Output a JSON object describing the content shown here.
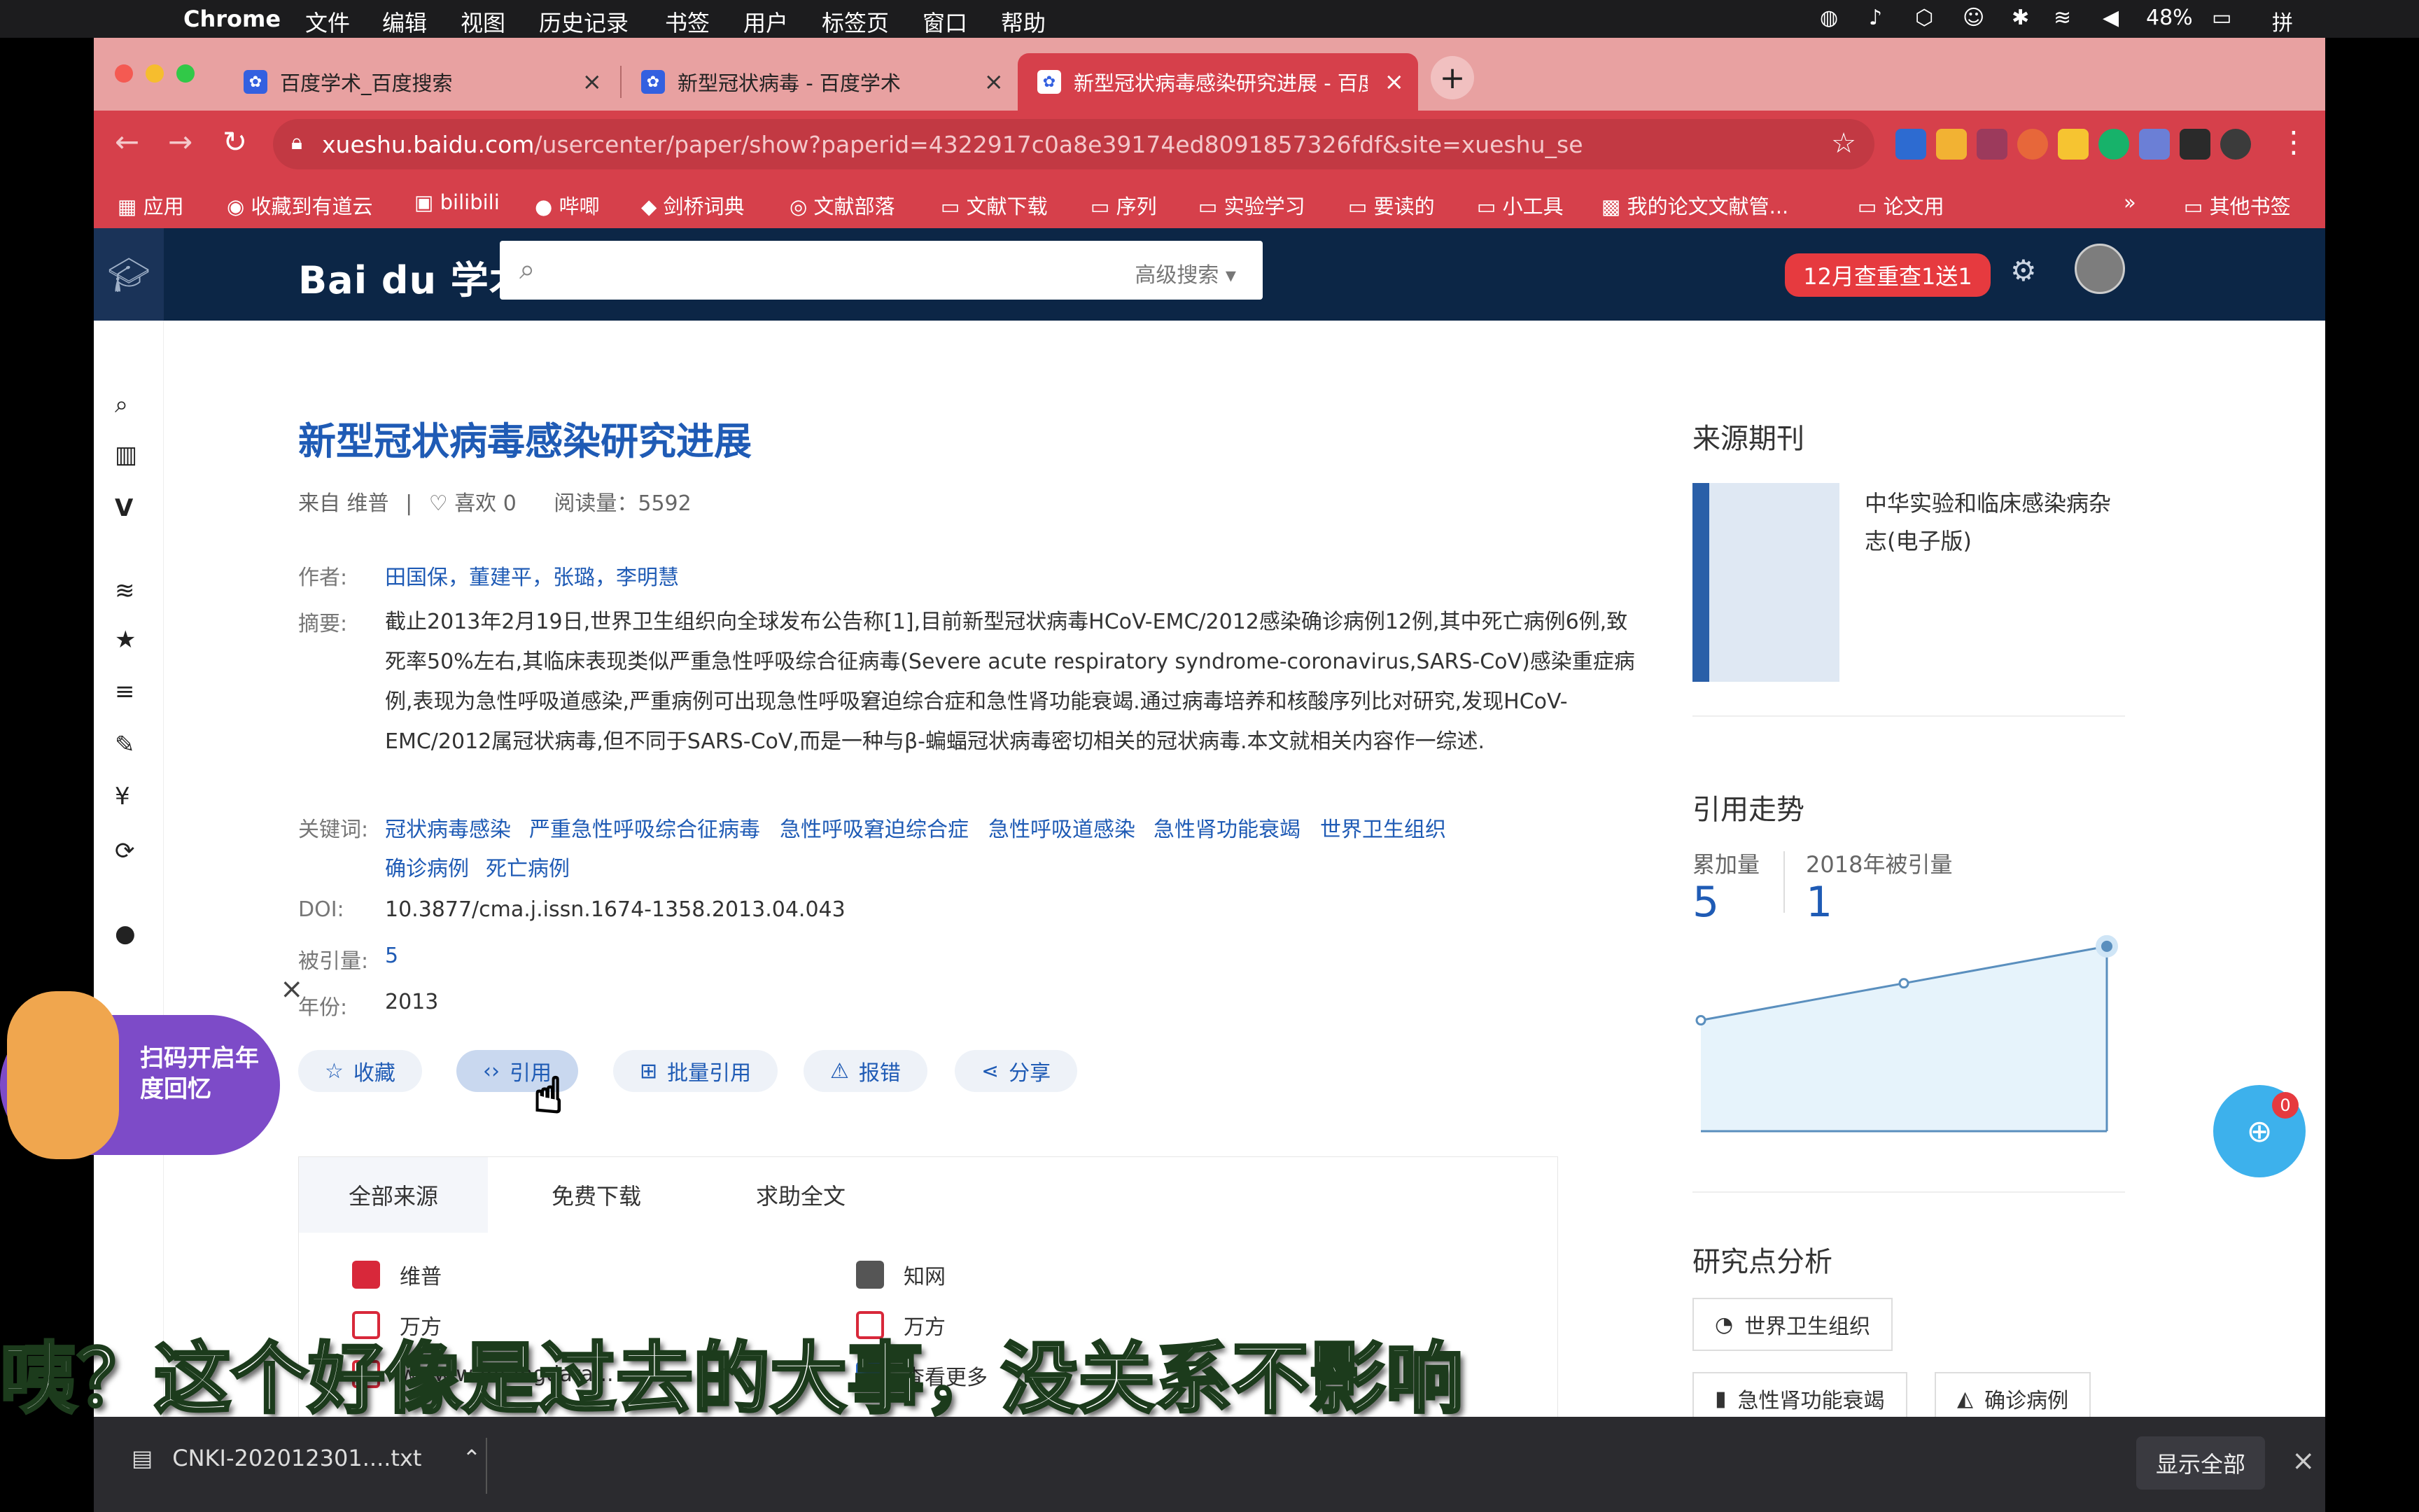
{
  "menubar": {
    "app": "Chrome",
    "items": [
      "文件",
      "编辑",
      "视图",
      "历史记录",
      "书签",
      "用户",
      "标签页",
      "窗口",
      "帮助"
    ],
    "battery": "48%"
  },
  "tabs": [
    {
      "title": "百度学术_百度搜索"
    },
    {
      "title": "新型冠状病毒 - 百度学术"
    },
    {
      "title": "新型冠状病毒感染研究进展 - 百度"
    }
  ],
  "address": {
    "host": "xueshu.baidu.com",
    "path": "/usercenter/paper/show?paperid=4322917c0a8e39174ed8091857326fdf&site=xueshu_se"
  },
  "bookmarks": [
    "应用",
    "收藏到有道云",
    "bilibili",
    "哔唧",
    "剑桥词典",
    "文献部落",
    "文献下载",
    "序列",
    "实验学习",
    "要读的",
    "小工具",
    "我的论文文献管...",
    "论文用",
    "其他书签"
  ],
  "header": {
    "brand": "Bai du 学术",
    "search_placeholder": "",
    "advanced": "高级搜索",
    "promo": "12月查重查1送1"
  },
  "paper": {
    "title": "新型冠状病毒感染研究进展",
    "source": "来自 维普",
    "likes": "喜欢 0",
    "reads": "阅读量：5592",
    "labels": {
      "authors": "作者:",
      "abstract": "摘要:",
      "keywords": "关键词:",
      "doi": "DOI:",
      "cited": "被引量:",
      "year": "年份:"
    },
    "authors": "田国保，董建平，张璐，李明慧",
    "abstract": "截止2013年2月19日,世界卫生组织向全球发布公告称[1],目前新型冠状病毒HCoV-EMC/2012感染确诊病例12例,其中死亡病例6例,致死率50%左右,其临床表现类似严重急性呼吸综合征病毒(Severe acute respiratory syndrome-coronavirus,SARS-CoV)感染重症病例,表现为急性呼吸道感染,严重病例可出现急性呼吸窘迫综合症和急性肾功能衰竭.通过病毒培养和核酸序列比对研究,发现HCoV-EMC/2012属冠状病毒,但不同于SARS-CoV,而是一种与β-蝙蝠冠状病毒密切相关的冠状病毒.本文就相关内容作一综述.",
    "keywords": [
      "冠状病毒感染",
      "严重急性呼吸综合征病毒",
      "急性呼吸窘迫综合症",
      "急性呼吸道感染",
      "急性肾功能衰竭",
      "世界卫生组织",
      "确诊病例",
      "死亡病例"
    ],
    "doi": "10.3877/cma.j.issn.1674-1358.2013.04.043",
    "cited": "5",
    "year": "2013"
  },
  "actions": [
    "收藏",
    "引用",
    "批量引用",
    "报错",
    "分享"
  ],
  "sources": {
    "tabs": [
      "全部来源",
      "免费下载",
      "求助全文"
    ],
    "items": [
      "维普",
      "知网",
      "万方",
      "万方",
      "www.wanfangdata...",
      "查看更多"
    ]
  },
  "right": {
    "journal_heading": "来源期刊",
    "journal_name": "中华实验和临床感染病杂志(电子版)",
    "trend_heading": "引用走势",
    "cum_label": "累加量",
    "cum_value": "5",
    "year_label": "2018年被引量",
    "year_value": "1",
    "analysis_heading": "研究点分析",
    "tags": [
      "世界卫生组织",
      "急性肾功能衰竭",
      "确诊病例"
    ]
  },
  "chart_data": {
    "type": "area",
    "values": [
      3,
      4,
      5
    ],
    "highlight_last": true
  },
  "float_badge": "0",
  "popup": "扫码开启年度回忆",
  "subtitle": "咦？这个好像是过去的大事，没关系不影响",
  "download": {
    "file": "CNKI-202012301....txt",
    "show_all": "显示全部"
  }
}
